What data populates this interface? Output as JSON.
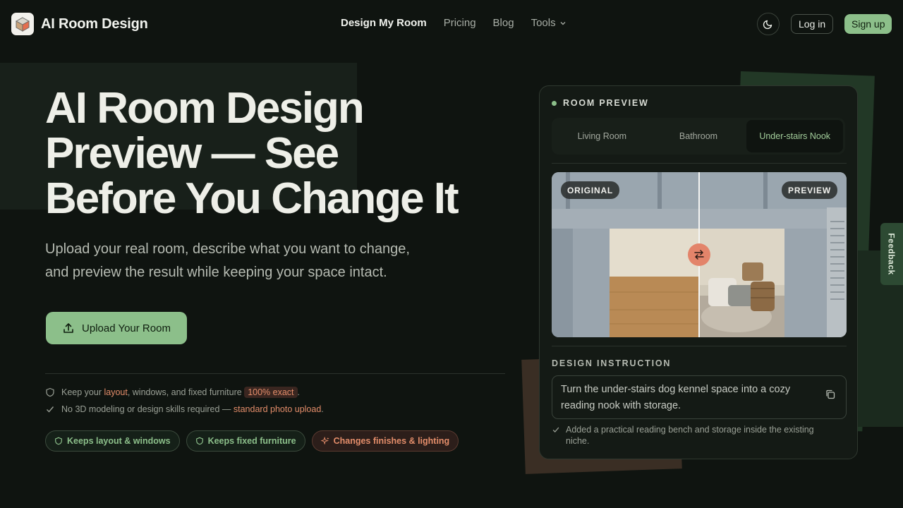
{
  "brand": {
    "name": "AI Room Design"
  },
  "nav": {
    "items": [
      "Design My Room",
      "Pricing",
      "Blog"
    ],
    "tools_label": "Tools"
  },
  "header": {
    "login_label": "Log in",
    "signup_label": "Sign up"
  },
  "hero": {
    "title_lines": [
      "AI Room Design",
      "Preview — See",
      "Before You Change It"
    ],
    "subtitle_line1": "Upload your real room, describe what you want to change,",
    "subtitle_line2": "and preview the result while keeping your space intact.",
    "upload_label": "Upload Your Room"
  },
  "features": {
    "row1": {
      "prefix": "Keep your ",
      "hl1": "layout",
      "mid": ", windows, and fixed furniture ",
      "hl2": "100% exact",
      "suffix": "."
    },
    "row2": {
      "prefix": "No 3D modeling or design skills required — ",
      "hl": "standard photo upload",
      "suffix": "."
    },
    "pills": [
      "Keeps layout & windows",
      "Keeps fixed furniture",
      "Changes finishes & lighting"
    ]
  },
  "preview": {
    "heading": "ROOM PREVIEW",
    "tabs": [
      "Living Room",
      "Bathroom",
      "Under-stairs Nook"
    ],
    "active_tab": "Under-stairs Nook",
    "badge_original": "ORIGINAL",
    "badge_preview": "PREVIEW",
    "instruction_label": "DESIGN INSTRUCTION",
    "instruction_text": "Turn the under-stairs dog kennel space into a cozy reading nook with storage.",
    "result_text": "Added a practical reading bench and storage inside the existing niche."
  },
  "feedback_label": "Feedback",
  "colors": {
    "accent_green": "#8cbf8a",
    "accent_orange": "#e38d6a",
    "background": "#0f1410"
  }
}
